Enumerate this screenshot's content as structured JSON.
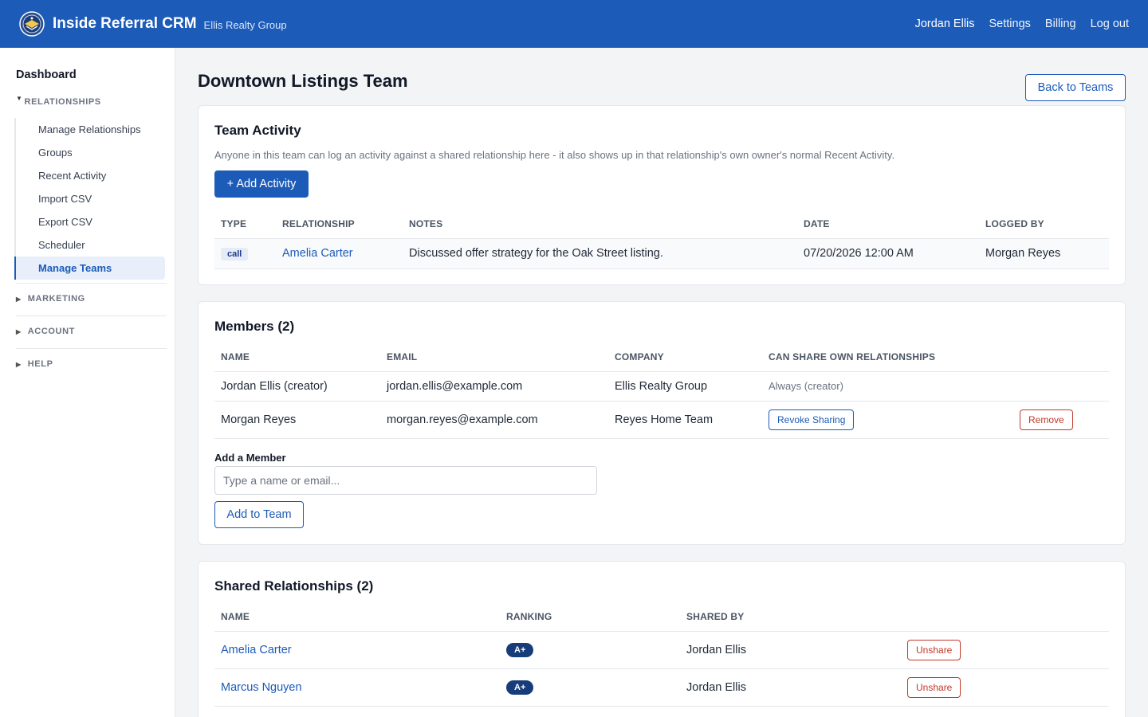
{
  "header": {
    "brand": "Inside Referral CRM",
    "org": "Ellis Realty Group",
    "nav": [
      {
        "label": "Jordan Ellis"
      },
      {
        "label": "Settings"
      },
      {
        "label": "Billing"
      },
      {
        "label": "Log out"
      }
    ]
  },
  "sidebar": {
    "dashboard": "Dashboard",
    "relationships": {
      "label": "RELATIONSHIPS",
      "items": [
        {
          "label": "Manage Relationships"
        },
        {
          "label": "Groups"
        },
        {
          "label": "Recent Activity"
        },
        {
          "label": "Import CSV"
        },
        {
          "label": "Export CSV"
        },
        {
          "label": "Scheduler"
        },
        {
          "label": "Manage Teams",
          "active": true
        }
      ]
    },
    "marketing": "MARKETING",
    "account": "ACCOUNT",
    "help": "HELP"
  },
  "page": {
    "title": "Downtown Listings Team",
    "back_label": "Back to Teams"
  },
  "activity": {
    "title": "Team Activity",
    "description": "Anyone in this team can log an activity against a shared relationship here - it also shows up in that relationship's own owner's normal Recent Activity.",
    "add_label": "+ Add Activity",
    "columns": [
      "TYPE",
      "RELATIONSHIP",
      "NOTES",
      "DATE",
      "LOGGED BY"
    ],
    "rows": [
      {
        "type": "call",
        "relationship": "Amelia Carter",
        "notes": "Discussed offer strategy for the Oak Street listing.",
        "date": "07/20/2026 12:00 AM",
        "logged_by": "Morgan Reyes"
      }
    ]
  },
  "members": {
    "title": "Members (2)",
    "columns": [
      "NAME",
      "EMAIL",
      "COMPANY",
      "CAN SHARE OWN RELATIONSHIPS"
    ],
    "rows": [
      {
        "name": "Jordan Ellis (creator)",
        "email": "jordan.ellis@example.com",
        "company": "Ellis Realty Group",
        "sharing": "Always (creator)"
      },
      {
        "name": "Morgan Reyes",
        "email": "morgan.reyes@example.com",
        "company": "Reyes Home Team",
        "sharing_action": "Revoke Sharing",
        "remove_label": "Remove"
      }
    ],
    "add_label": "Add a Member",
    "input_placeholder": "Type a name or email...",
    "add_button": "Add to Team"
  },
  "shared": {
    "title": "Shared Relationships (2)",
    "columns": [
      "NAME",
      "RANKING",
      "SHARED BY"
    ],
    "rows": [
      {
        "name": "Amelia Carter",
        "ranking": "A+",
        "shared_by": "Jordan Ellis",
        "action": "Unshare"
      },
      {
        "name": "Marcus Nguyen",
        "ranking": "A+",
        "shared_by": "Jordan Ellis",
        "action": "Unshare"
      }
    ]
  },
  "colors": {
    "primary": "#1c5bb8",
    "danger": "#c0392b",
    "badge": "#163d7a"
  }
}
